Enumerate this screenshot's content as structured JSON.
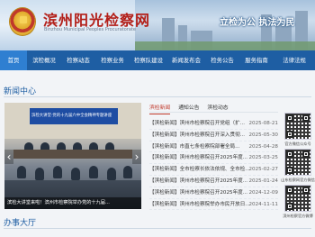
{
  "header": {
    "site_title": "滨州阳光检察网",
    "site_subtitle": "Binzhou Municipal Peoples Procuratorate",
    "slogan": "立检为公 执法为民"
  },
  "nav": {
    "items": [
      {
        "label": "首页",
        "active": true
      },
      {
        "label": "滨检概况",
        "active": false
      },
      {
        "label": "检察动态",
        "active": false
      },
      {
        "label": "检察业务",
        "active": false
      },
      {
        "label": "检察队建设",
        "active": false
      },
      {
        "label": "新闻发布会",
        "active": false
      },
      {
        "label": "检务公告",
        "active": false
      },
      {
        "label": "服务指南",
        "active": false
      },
      {
        "label": "法律法规",
        "active": false
      }
    ]
  },
  "news_center": {
    "title": "新闻中心",
    "photo_caption": "滨检大讲堂来啦！滨州市检察院举办党的十九届...",
    "photo_screen_text": "滨检大讲堂·党的十九届六中全会精神专题讲座",
    "tabs": [
      {
        "label": "滨检新闻",
        "active": true
      },
      {
        "label": "通知公告",
        "active": false
      },
      {
        "label": "滨检动态",
        "active": false
      }
    ],
    "items": [
      {
        "tag": "【滨检新闻】",
        "title": "滨州市检察院召开党组（扩...",
        "date": "2025-08-21"
      },
      {
        "tag": "【滨检新闻】",
        "title": "滨州市检察院召开深入贯彻...",
        "date": "2025-05-30"
      },
      {
        "tag": "【滨检新闻】",
        "title": "市直七条检察院部署全局...",
        "date": "2025-04-28"
      },
      {
        "tag": "【滨检新闻】",
        "title": "滨州市检察院召开2025年度...",
        "date": "2025-03-25"
      },
      {
        "tag": "【滨检新闻】",
        "title": "全市检察长依法依规、全市检...",
        "date": "2025-02-27"
      },
      {
        "tag": "【滨检新闻】",
        "title": "滨州市检察院召开2025年度...",
        "date": "2025-01-24"
      },
      {
        "tag": "【滨检新闻】",
        "title": "滨州市检察院召开2025年度...",
        "date": "2024-12-09"
      },
      {
        "tag": "【滨检新闻】",
        "title": "滨州市检察院举办市民开放日...",
        "date": "2024-11-11"
      }
    ]
  },
  "qr_codes": [
    {
      "label": "官方微信公众号"
    },
    {
      "label": "山东检察网官方微信"
    },
    {
      "label": "滨州检察官方微博"
    }
  ],
  "service_hall": {
    "title": "办事大厅"
  }
}
